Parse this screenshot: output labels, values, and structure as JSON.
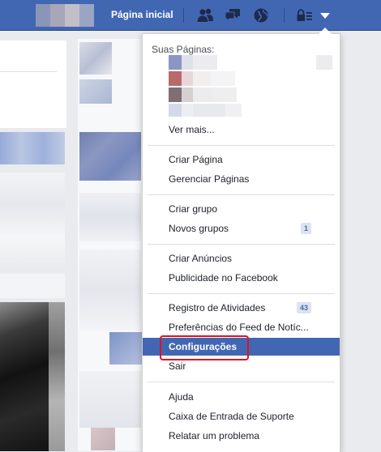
{
  "topbar": {
    "home_label": "Página inicial",
    "icons": [
      "friend-requests-icon",
      "messages-icon",
      "notifications-globe-icon",
      "privacy-lock-icon",
      "account-dropdown-icon"
    ],
    "bar_color": "#4267b2"
  },
  "menu": {
    "pages_header": "Suas Páginas:",
    "see_more": "Ver mais...",
    "group_pages": [
      {
        "label": "Criar Página"
      },
      {
        "label": "Gerenciar Páginas"
      }
    ],
    "group_groups": [
      {
        "label": "Criar grupo"
      },
      {
        "label": "Novos grupos",
        "badge": "1"
      }
    ],
    "group_ads": [
      {
        "label": "Criar Anúncios"
      },
      {
        "label": "Publicidade no Facebook"
      }
    ],
    "group_account": [
      {
        "label": "Registro de Atividades",
        "badge": "43"
      },
      {
        "label": "Preferências do Feed de Notíc..."
      },
      {
        "label": "Configurações",
        "active": true
      },
      {
        "label": "Sair"
      }
    ],
    "group_help": [
      {
        "label": "Ajuda"
      },
      {
        "label": "Caixa de Entrada de Suporte"
      },
      {
        "label": "Relatar um problema"
      }
    ],
    "active_color": "#4267b2",
    "highlight_color": "#e0121f"
  }
}
